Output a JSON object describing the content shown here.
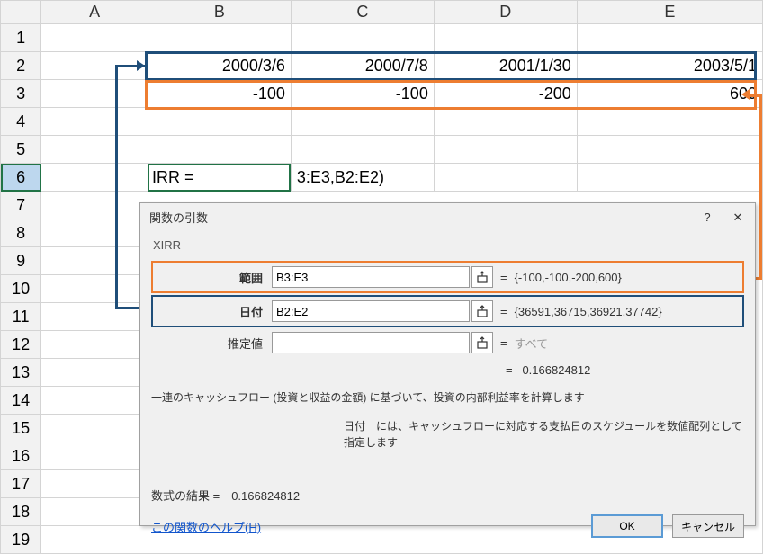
{
  "columns": [
    "",
    "A",
    "B",
    "C",
    "D",
    "E"
  ],
  "rows": [
    "1",
    "2",
    "3",
    "4",
    "5",
    "6",
    "7",
    "8",
    "9",
    "10",
    "11",
    "12",
    "13",
    "14",
    "15",
    "16",
    "17",
    "18",
    "19"
  ],
  "data": {
    "B2": "2000/3/6",
    "C2": "2000/7/8",
    "D2": "2001/1/30",
    "E2": "2003/5/1",
    "B3": "-100",
    "C3": "-100",
    "D3": "-200",
    "E3": "600",
    "B6": "IRR =",
    "C6": "3:E3,B2:E2)"
  },
  "dialog": {
    "title": "関数の引数",
    "function_name": "XIRR",
    "args": {
      "range_label": "範囲",
      "range_value": "B3:E3",
      "range_eval": "{-100,-100,-200,600}",
      "dates_label": "日付",
      "dates_value": "B2:E2",
      "dates_eval": "{36591,36715,36921,37742}",
      "guess_label": "推定値",
      "guess_value": "",
      "guess_eval": "すべて"
    },
    "eq_sign": "=",
    "calc_result": "0.166824812",
    "desc_line1": "一連のキャッシュフロー (投資と収益の金額) に基づいて、投資の内部利益率を計算します",
    "desc_line2": "日付　には、キャッシュフローに対応する支払日のスケジュールを数値配列として指定します",
    "result_label": "数式の結果 =　0.166824812",
    "help_link": "この関数のヘルプ(H)",
    "ok_label": "OK",
    "cancel_label": "キャンセル",
    "help_icon": "?",
    "close_icon": "✕"
  }
}
